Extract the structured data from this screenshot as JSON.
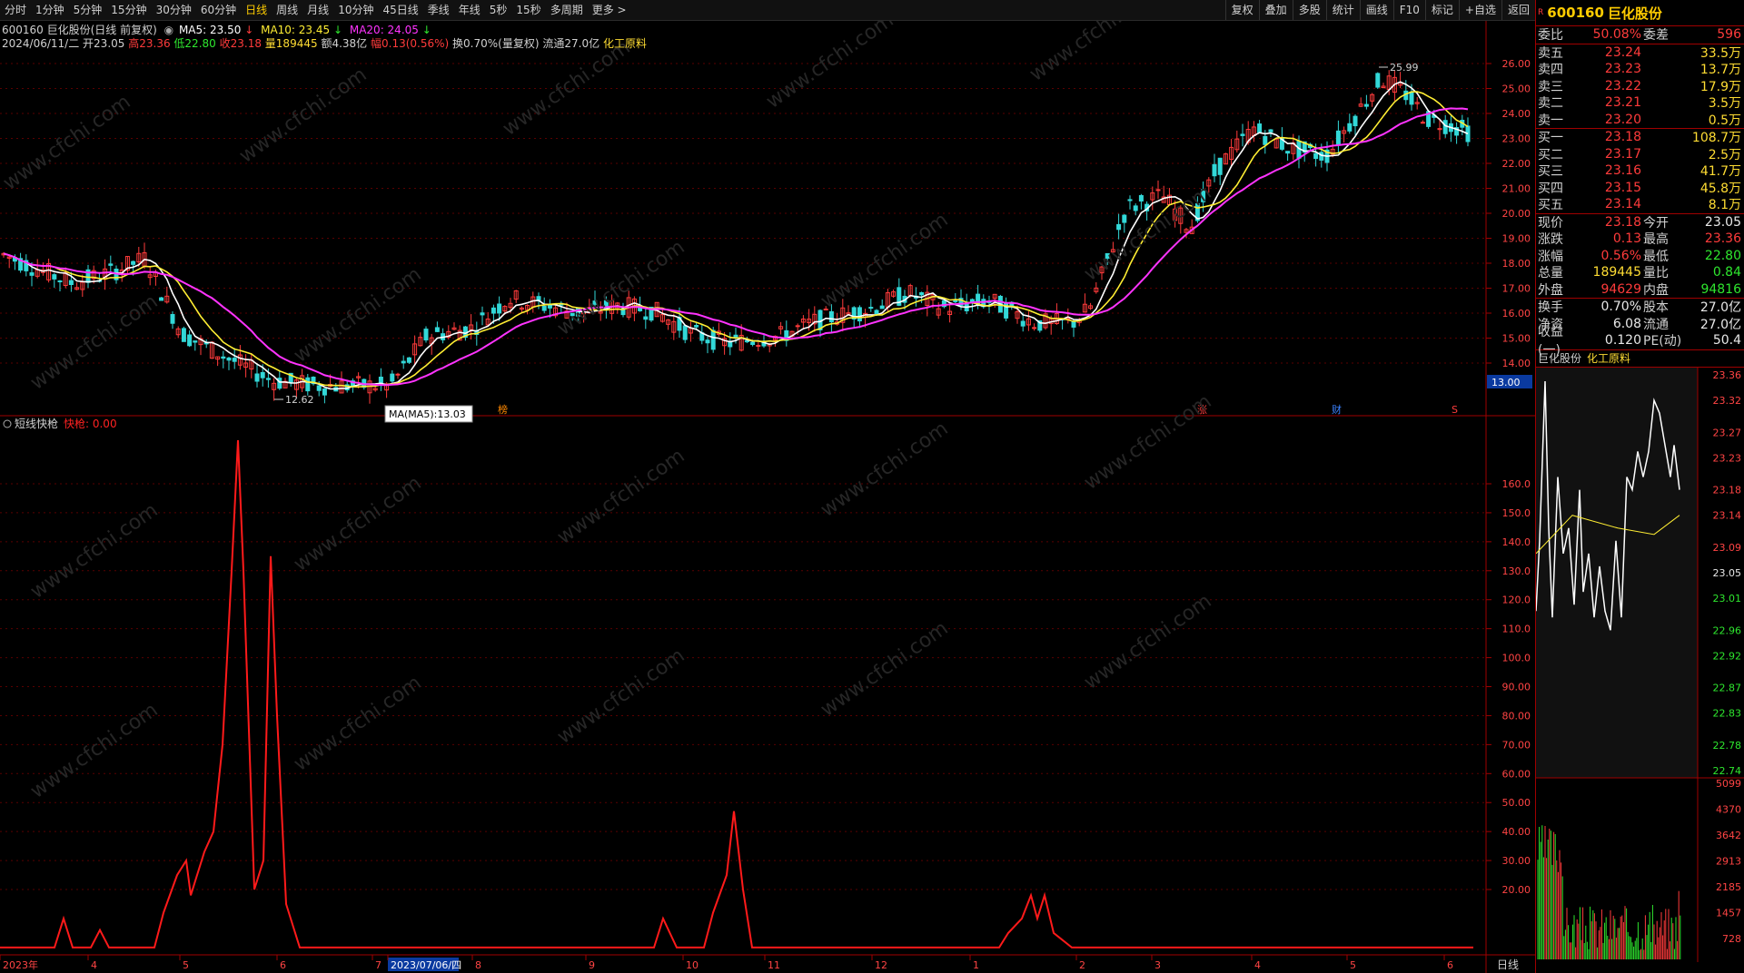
{
  "toolbar": {
    "periods": [
      "分时",
      "1分钟",
      "5分钟",
      "15分钟",
      "30分钟",
      "60分钟",
      "日线",
      "周线",
      "月线",
      "10分钟",
      "45日线",
      "季线",
      "年线",
      "5秒",
      "15秒",
      "多周期",
      "更多 >"
    ],
    "active": "日线",
    "right_buttons": [
      "复权",
      "叠加",
      "多股",
      "统计",
      "画线",
      "F10",
      "标记",
      "+自选",
      "返回"
    ]
  },
  "info": {
    "code_name": "600160 巨化股份(日线 前复权)",
    "ma5": "MA5: 23.50",
    "ma10": "MA10: 23.45",
    "ma20": "MA20: 24.05",
    "date": "2024/06/11/二",
    "open": "开23.05",
    "high": "高23.36",
    "low": "低22.80",
    "close": "收23.18",
    "volume": "量189445",
    "amount": "额4.38亿",
    "change": "幅0.13(0.56%)",
    "turnover": "换0.70%(量复权)",
    "float": "流通27.0亿",
    "sector": "化工原料"
  },
  "main_axis": [
    "26.00",
    "25.00",
    "24.00",
    "23.00",
    "22.00",
    "21.00",
    "20.00",
    "19.00",
    "18.00",
    "17.00",
    "16.00",
    "15.00",
    "14.00"
  ],
  "main_cursor_price": "13.00",
  "annotations": {
    "high_label": "25.99",
    "low_label": "12.62",
    "tooltip": "MA(MA5):13.03",
    "markers": [
      "榜",
      "涨",
      "财",
      "S"
    ]
  },
  "indicator": {
    "title": "短线快枪",
    "sub": "快枪: 0.00",
    "axis": [
      "160.0",
      "150.0",
      "140.0",
      "130.0",
      "120.0",
      "110.0",
      "100.0",
      "90.00",
      "80.00",
      "70.00",
      "60.00",
      "50.00",
      "40.00",
      "30.00",
      "20.00"
    ]
  },
  "xaxis": {
    "labels": [
      "2023年",
      "4",
      "5",
      "6",
      "7",
      "2023/07/06/四",
      "8",
      "9",
      "10",
      "11",
      "12",
      "1",
      "2",
      "3",
      "4",
      "5",
      "6"
    ],
    "footer": "日线"
  },
  "quote": {
    "code": "600160",
    "name": "巨化股份",
    "webi_label": "委比",
    "webi": "50.08%",
    "weicha_label": "委差",
    "weicha": "596",
    "asks": [
      {
        "label": "卖五",
        "price": "23.24",
        "vol": "33.5万"
      },
      {
        "label": "卖四",
        "price": "23.23",
        "vol": "13.7万"
      },
      {
        "label": "卖三",
        "price": "23.22",
        "vol": "17.9万"
      },
      {
        "label": "卖二",
        "price": "23.21",
        "vol": "3.5万"
      },
      {
        "label": "卖一",
        "price": "23.20",
        "vol": "0.5万"
      }
    ],
    "bids": [
      {
        "label": "买一",
        "price": "23.18",
        "vol": "108.7万"
      },
      {
        "label": "买二",
        "price": "23.17",
        "vol": "2.5万"
      },
      {
        "label": "买三",
        "price": "23.16",
        "vol": "41.7万"
      },
      {
        "label": "买四",
        "price": "23.15",
        "vol": "45.8万"
      },
      {
        "label": "买五",
        "price": "23.14",
        "vol": "8.1万"
      }
    ],
    "stats": [
      {
        "l1": "现价",
        "v1": "23.18",
        "c1": "red",
        "l2": "今开",
        "v2": "23.05",
        "c2": "white"
      },
      {
        "l1": "涨跌",
        "v1": "0.13",
        "c1": "red",
        "l2": "最高",
        "v2": "23.36",
        "c2": "red"
      },
      {
        "l1": "涨幅",
        "v1": "0.56%",
        "c1": "red",
        "l2": "最低",
        "v2": "22.80",
        "c2": "green"
      },
      {
        "l1": "总量",
        "v1": "189445",
        "c1": "yellow",
        "l2": "量比",
        "v2": "0.84",
        "c2": "green"
      },
      {
        "l1": "外盘",
        "v1": "94629",
        "c1": "red",
        "l2": "内盘",
        "v2": "94816",
        "c2": "green"
      }
    ],
    "stats2": [
      {
        "l1": "换手",
        "v1": "0.70%",
        "l2": "股本",
        "v2": "27.0亿"
      },
      {
        "l1": "净资",
        "v1": "6.08",
        "l2": "流通",
        "v2": "27.0亿"
      },
      {
        "l1": "收益(一)",
        "v1": "0.120",
        "l2": "PE(动)",
        "v2": "50.4"
      }
    ]
  },
  "mini": {
    "name": "巨化股份",
    "sector": "化工原料",
    "axis": [
      "23.36",
      "23.32",
      "23.27",
      "23.23",
      "23.18",
      "23.14",
      "23.09",
      "23.05",
      "23.01",
      "22.96",
      "22.92",
      "22.87",
      "22.83",
      "22.78",
      "22.74"
    ],
    "vol_axis": [
      "5099",
      "4370",
      "3642",
      "2913",
      "2185",
      "1457",
      "728"
    ]
  },
  "watermark": "www.cfchi.com",
  "colors": {
    "up": "#ff3b3b",
    "down": "#32d8d8",
    "ma5": "#ffffff",
    "ma10": "#ffee33",
    "ma20": "#ff33ff",
    "indicator": "#ff1a1a",
    "grid": "#5a0000"
  }
}
